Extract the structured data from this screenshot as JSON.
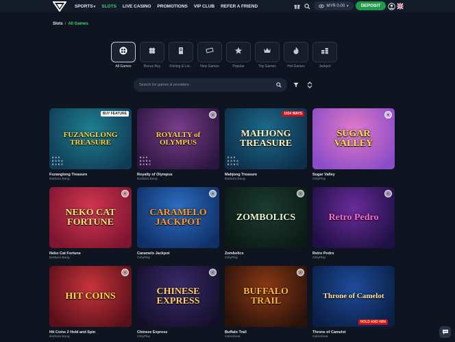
{
  "nav": {
    "items": [
      {
        "label": "SPORTS",
        "caret": "▾",
        "active": false
      },
      {
        "label": "SLOTS",
        "caret": "",
        "active": true
      },
      {
        "label": "LIVE CASINO",
        "caret": "",
        "active": false
      },
      {
        "label": "PROMOTIONS",
        "caret": "",
        "active": false
      },
      {
        "label": "VIP CLUB",
        "caret": "",
        "active": false
      },
      {
        "label": "REFER A FRIEND",
        "caret": "",
        "active": false
      }
    ],
    "wallet": {
      "currency_amount": "MYR 0.00",
      "caret": "▾"
    },
    "deposit_label": "DEPOSIT"
  },
  "breadcrumb": {
    "first": "Slots",
    "separator": "/",
    "current": "All Games"
  },
  "categories": [
    {
      "label": "All Games",
      "icon": "grid-icon",
      "active": true
    },
    {
      "label": "Bonus Buy",
      "icon": "clover-icon",
      "active": false
    },
    {
      "label": "Fishing & Lot...",
      "icon": "ticket-icon",
      "active": false
    },
    {
      "label": "New Games",
      "icon": "ticket-slant-icon",
      "active": false
    },
    {
      "label": "Popular",
      "icon": "star-icon",
      "active": false
    },
    {
      "label": "Top Games",
      "icon": "crown-icon",
      "active": false
    },
    {
      "label": "Hot Games",
      "icon": "flame-icon",
      "active": false
    },
    {
      "label": "Jackpot",
      "icon": "coins-icon",
      "active": false
    }
  ],
  "search": {
    "placeholder": "Search for games & providers"
  },
  "games": [
    {
      "name": "Fuzanglong Treasure",
      "provider": "Barbara Bang",
      "art": "FUZANGLONG TREASURE",
      "tag": "BUY FEATURE",
      "bg": "#1f7f8f",
      "bg2": "#0f3c56",
      "fg": "#ffd84a"
    },
    {
      "name": "Royalty of Olympus",
      "provider": "Barbara Bang",
      "art": "ROYALTY of OLYMPUS",
      "tag": "",
      "bg": "#7a3d8c",
      "bg2": "#2c1640",
      "fg": "#ffd24a"
    },
    {
      "name": "Mahjong Treasure",
      "provider": "Barbara Bang",
      "art": "MAHJONG TREASURE",
      "tag": "1024 WAYS",
      "bg": "#1c6a8c",
      "bg2": "#0d2f4a",
      "fg": "#fff3c0"
    },
    {
      "name": "Sugar Valley",
      "provider": "OnlyPlay",
      "art": "SUGAR VALLEY",
      "tag": "",
      "bg": "#e07ac8",
      "bg2": "#8b4cc9",
      "fg": "#ffe04a"
    },
    {
      "name": "Neko Cat Fortune",
      "provider": "Barbara Bang",
      "art": "NEKO CAT FORTUNE",
      "tag": "",
      "bg": "#d2364f",
      "bg2": "#7e1530",
      "fg": "#ffe17a"
    },
    {
      "name": "Caramelo Jackpot",
      "provider": "OnlyPlay",
      "art": "CARAMELO JACKPOT",
      "tag": "",
      "bg": "#2d6ec2",
      "bg2": "#0f2f66",
      "fg": "#ff9a2e"
    },
    {
      "name": "Zombolics",
      "provider": "OnlyPlay",
      "art": "ZOMBOLICS",
      "tag": "",
      "bg": "#1c3b30",
      "bg2": "#0b1a15",
      "fg": "#e9f3d2"
    },
    {
      "name": "Retro Pedro",
      "provider": "OnlyPlay",
      "art": "Retro Pedro",
      "tag": "",
      "bg": "#6a2c9a",
      "bg2": "#1f1045",
      "fg": "#ff6ad5"
    },
    {
      "name": "Hit Coins 2 Hold and Spin",
      "provider": "Barbara Bang",
      "art": "HIT COINS",
      "tag": "",
      "bg": "#c7353a",
      "bg2": "#5a0f1a",
      "fg": "#ffd84a"
    },
    {
      "name": "Chinese Express",
      "provider": "OnlyPlay",
      "art": "CHINESE EXPRESS",
      "tag": "",
      "bg": "#3a2a6a",
      "bg2": "#14102c",
      "fg": "#ffcf6a"
    },
    {
      "name": "Buffalo Trail",
      "provider": "Gamebeat",
      "art": "BUFFALO TRAIL",
      "tag": "",
      "bg": "#8b3a14",
      "bg2": "#2a120a",
      "fg": "#ffb53a"
    },
    {
      "name": "Throne of Camelot",
      "provider": "Gamebeat",
      "art": "Throne of Camelot",
      "tag": "HOLD AND WIN",
      "bg": "#1e4b9a",
      "bg2": "#0a1f45",
      "fg": "#ffe6a0"
    }
  ],
  "bb_mark": "BAR BARA BANG",
  "accent": "#3fd66e",
  "deposit_color": "#1f9c4a"
}
